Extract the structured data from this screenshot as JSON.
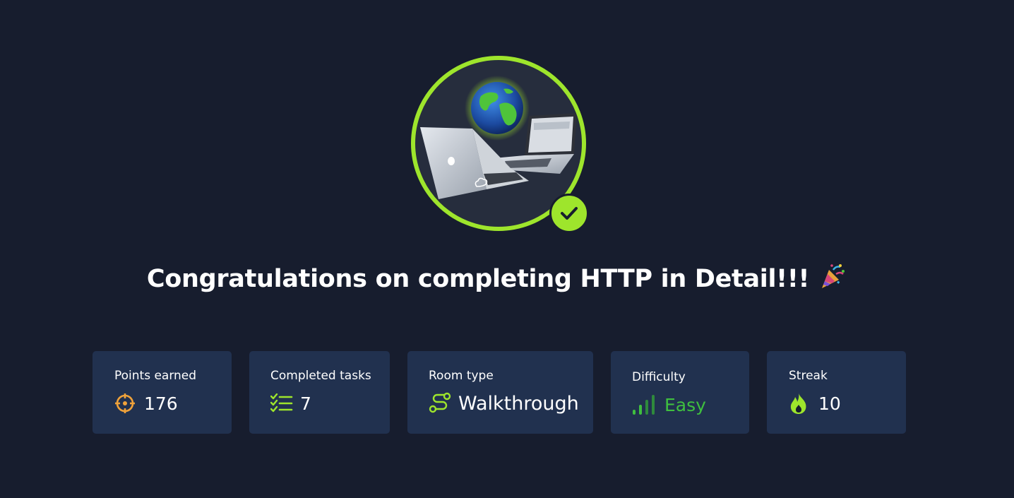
{
  "room": {
    "badge_icon": "laptops-globe-icon",
    "completed_icon": "check-icon",
    "title": "Congratulations on completing HTTP in Detail!!!",
    "title_emoji": "party-popper-icon"
  },
  "stats": [
    {
      "label": "Points earned",
      "value": "176",
      "icon": "crosshair-icon"
    },
    {
      "label": "Completed tasks",
      "value": "7",
      "icon": "checklist-icon"
    },
    {
      "label": "Room type",
      "value": "Walkthrough",
      "icon": "route-icon"
    },
    {
      "label": "Difficulty",
      "value": "Easy",
      "icon": "signal-bars-icon"
    },
    {
      "label": "Streak",
      "value": "10",
      "icon": "flame-icon"
    }
  ],
  "colors": {
    "background": "#171d2e",
    "card": "#21314f",
    "accent": "#9ee52c",
    "easy": "#3fbf3f",
    "points_icon": "#f0a23a"
  }
}
